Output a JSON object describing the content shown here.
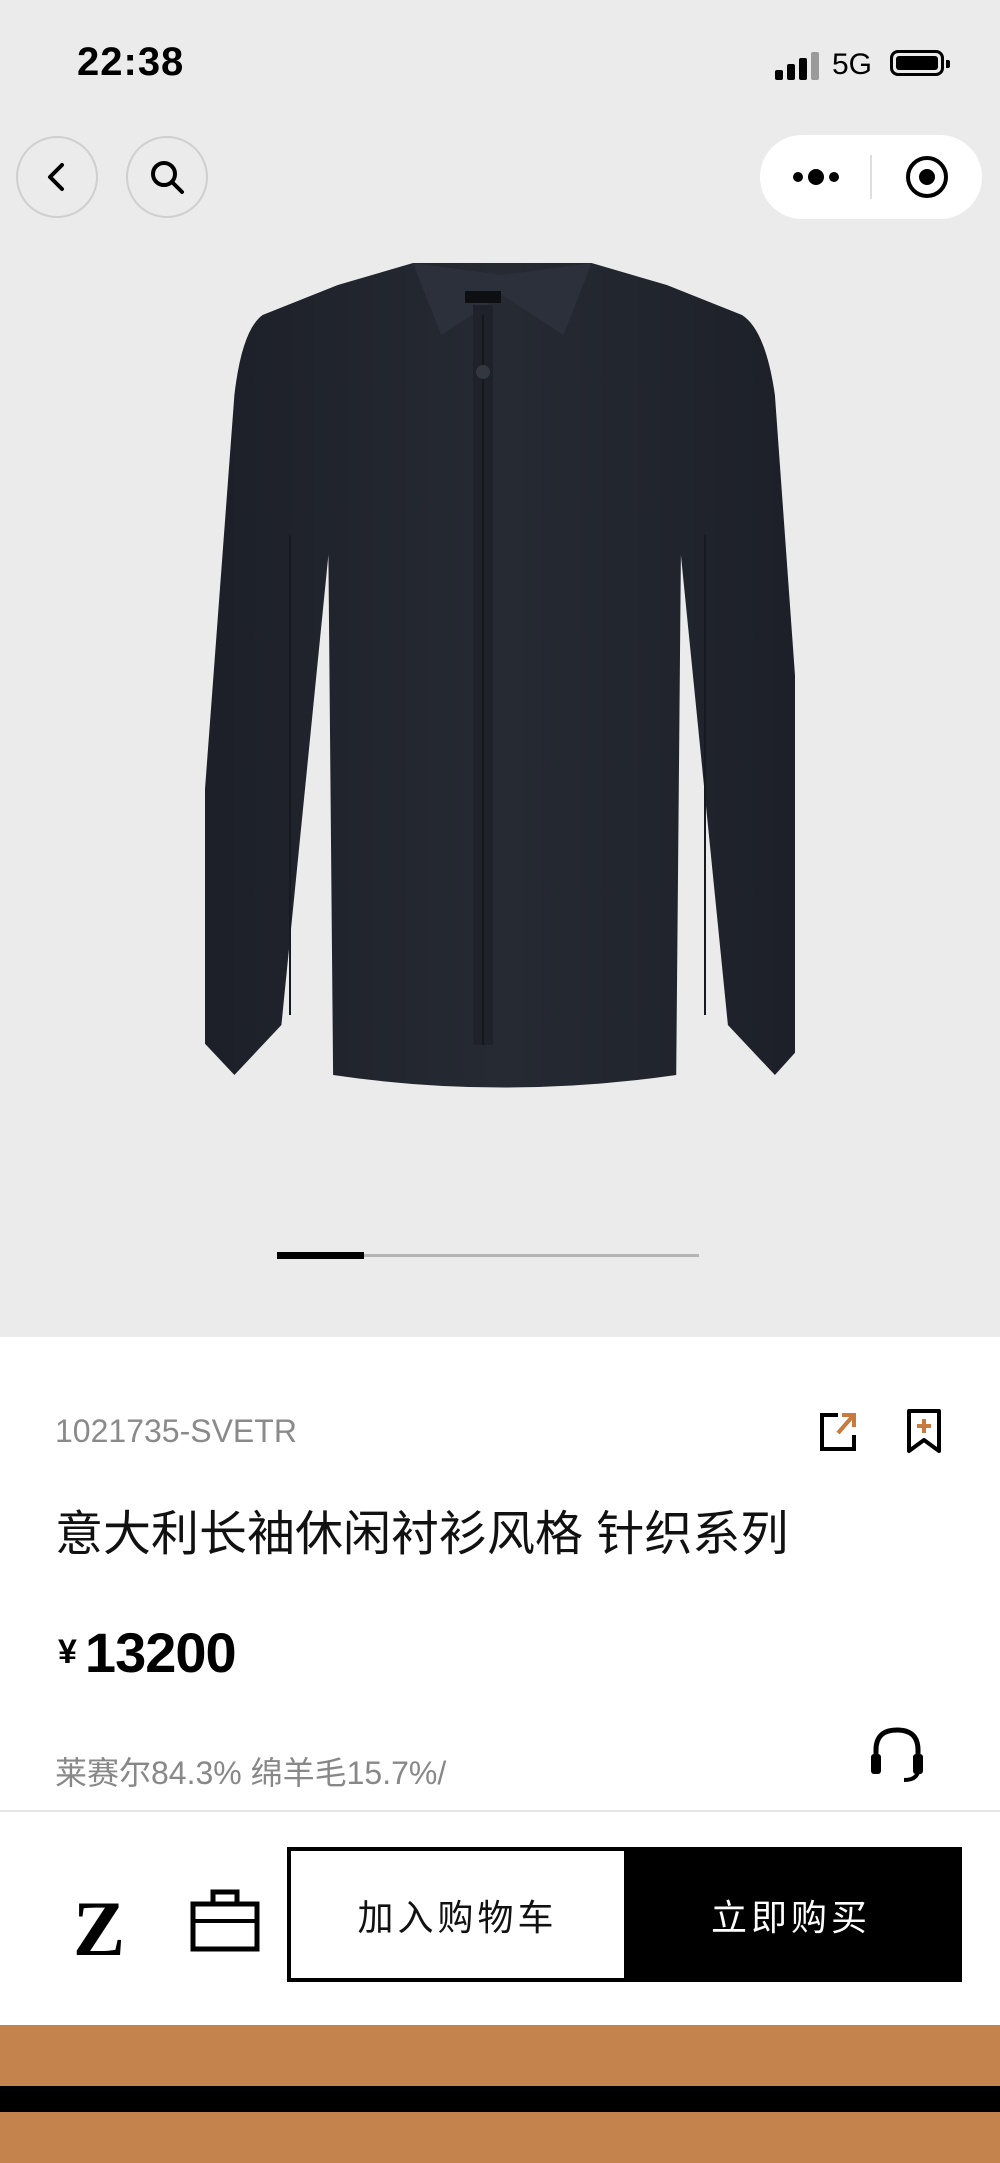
{
  "status_bar": {
    "time": "22:38",
    "network": "5G",
    "battery_level": 1.0
  },
  "nav": {
    "back_icon": "chevron-left-icon",
    "search_icon": "search-icon",
    "more_icon": "more-dots-icon",
    "target_icon": "record-target-icon"
  },
  "gallery": {
    "current_index": 1,
    "progress_fraction": 0.2
  },
  "product": {
    "sku": "1021735-SVETR",
    "title": "意大利长袖休闲衬衫风格  针织系列",
    "currency_symbol": "¥",
    "price": "13200",
    "material": "莱赛尔84.3%  绵羊毛15.7%/"
  },
  "actions": {
    "share_icon": "share-icon",
    "favorite_icon": "bookmark-add-icon",
    "service_icon": "customer-service-headset-icon",
    "brand_mark": "Z",
    "bag_icon": "shopping-bag-icon",
    "add_to_cart": "加入购物车",
    "buy_now": "立即购买"
  },
  "colors": {
    "hero_bg": "#ebebeb",
    "accent_brown": "#c4834c",
    "share_accent": "#c97a3e",
    "shirt_navy": "#23262f"
  }
}
